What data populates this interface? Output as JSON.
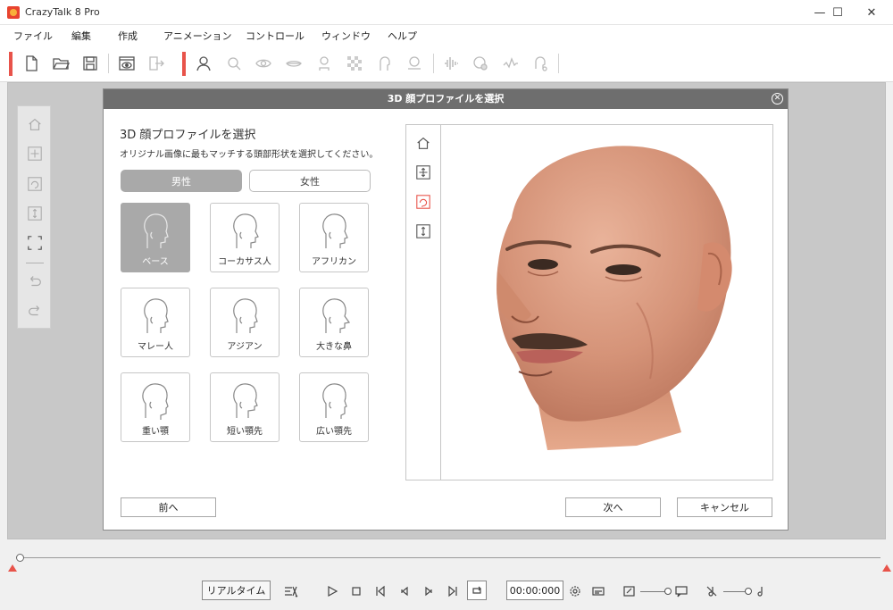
{
  "window": {
    "title": "CrazyTalk 8 Pro",
    "controls": {
      "minimize": "—",
      "maximize": "☐",
      "close": "✕"
    }
  },
  "menu": [
    "ファイル",
    "編集",
    "作成",
    "アニメーション",
    "コントロール",
    "ウィンドウ",
    "ヘルプ"
  ],
  "toolbar_icons": [
    "new-file-icon",
    "open-folder-icon",
    "save-icon",
    "preview-icon",
    "export-icon",
    "face-fitting-icon",
    "eye-settings-icon",
    "eye-icon",
    "mouth-icon",
    "head-icon",
    "background-mask-icon",
    "face-profile-icon",
    "bg-removal-icon",
    "audio-icon",
    "motion-icon",
    "script-icon",
    "puppet-icon"
  ],
  "left_tools": [
    "home-icon",
    "move-icon",
    "rotate-view-icon",
    "zoom-icon",
    "fit-icon",
    "undo-icon",
    "redo-icon"
  ],
  "dialog": {
    "header": "3D 顔プロファイルを選択",
    "close": "✕",
    "title": "3D 顔プロファイルを選択",
    "subtitle": "オリジナル画像に最もマッチする頭部形状を選択してください。",
    "gender": {
      "male": "男性",
      "female": "女性",
      "selected": "男性"
    },
    "profiles": [
      {
        "label": "ベース",
        "selected": true
      },
      {
        "label": "コーカサス人",
        "selected": false
      },
      {
        "label": "アフリカン",
        "selected": false
      },
      {
        "label": "マレー人",
        "selected": false
      },
      {
        "label": "アジアン",
        "selected": false
      },
      {
        "label": "大きな鼻",
        "selected": false
      },
      {
        "label": "重い顎",
        "selected": false
      },
      {
        "label": "短い顎先",
        "selected": false
      },
      {
        "label": "広い顎先",
        "selected": false
      }
    ],
    "preview_tools": [
      "home-icon",
      "move-icon",
      "rotate-icon",
      "zoom-icon"
    ],
    "buttons": {
      "back": "前へ",
      "next": "次へ",
      "cancel": "キャンセル"
    }
  },
  "bottom": {
    "realtime": "リアルタイム",
    "timecode": "00:00:000"
  },
  "colors": {
    "accent": "#e8534a",
    "dialog_header": "#6e6e6e",
    "selected_tile": "#a9a9a9"
  }
}
